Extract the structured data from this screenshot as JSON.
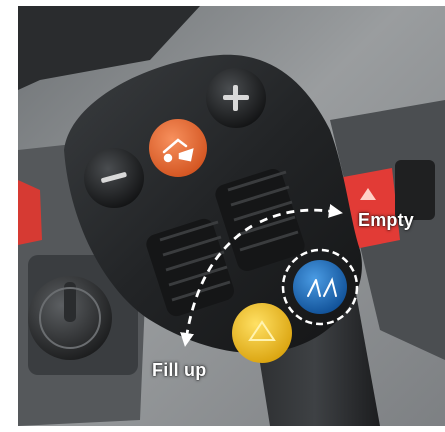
{
  "annotations": {
    "empty_label": "Empty",
    "fill_label": "Fill up"
  },
  "icons": {
    "minus_button": "minus-icon",
    "plus_button": "plus-icon",
    "orange_button": "bucket-icon",
    "blue_button": "wiper-icon",
    "yellow_button": "triangle-icon",
    "red_button": "warning-icon"
  },
  "colors": {
    "orange_button": "#ef6a32",
    "blue_button": "#1e74c7",
    "yellow_button": "#f2c31a",
    "red_button": "#e23b36",
    "annotation_arrows": "#ffffff"
  }
}
